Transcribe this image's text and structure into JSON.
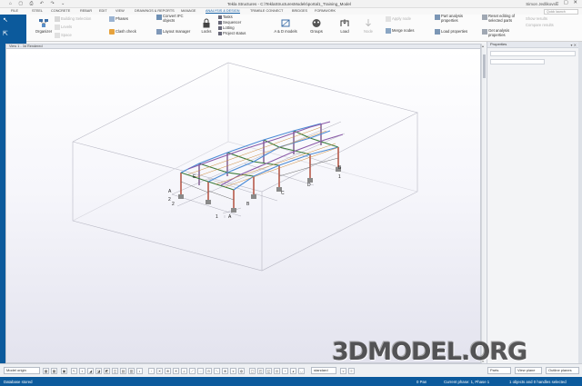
{
  "titlebar": {
    "title": "Tekla Structures - C:\\TeklaStructuresModels\\portal1_Training_Model",
    "user": "Simon Jedlikovski",
    "quick_access_icons": "⌂ ▢ ⎙ ↶ ↷ ⌄",
    "window_buttons": "– ▢ ✕"
  },
  "menu": {
    "tabs": [
      "FILE",
      "STEEL",
      "CONCRETE",
      "REBAR",
      "EDIT",
      "VIEW",
      "DRAWINGS & REPORTS",
      "MANAGE",
      "ANALYSIS & DESIGN",
      "TRIMBLE CONNECT",
      "BRIDGES",
      "FORMWORK"
    ],
    "active_tab": "ANALYSIS & DESIGN",
    "search_placeholder": "Quick launch"
  },
  "ribbon": {
    "organizer": "Organizer",
    "building_selection": "Building Selection",
    "levels": "Levels",
    "space": "Space",
    "phases": "Phases",
    "clash_check": "Clash check",
    "convert_ifc": "Convert IFC objects",
    "layout_manager": "Layout manager",
    "locks": "Locks",
    "tasks": "Tasks",
    "sequencer": "Sequencer",
    "lotting": "Lotting",
    "project_status": "Project status",
    "ad_models": "A & D models",
    "groups": "Groups",
    "load": "Load",
    "node": "Node",
    "merge_nodes": "Merge nodes",
    "apply_node": "Apply node",
    "part_analysis": "Part analysis properties",
    "load_properties": "Load properties",
    "reset_editing": "Reset editing of selected parts",
    "get_analysis": "Get analysis properties",
    "show_results": "Show results",
    "compare_results": "Compare results"
  },
  "view": {
    "header": "View 1 - 3d Rendered",
    "labels": {
      "a1": "A",
      "a2": "2",
      "b1": "1",
      "b2": "A",
      "c1": "1",
      "c2": "B",
      "grid_b": "B",
      "grid_c": "C",
      "grid_d": "D",
      "grid_e": "E",
      "num2": "2"
    }
  },
  "panel": {
    "title": "Properties",
    "controls": "▾ ✕"
  },
  "bottombar": {
    "model_origin": "Model origin",
    "standard": "standard",
    "parts_combo": "Parts",
    "view_plane": "View plane",
    "outline_planes": "Outline planes"
  },
  "status": {
    "left": "Database stored",
    "coords": "0  Pan",
    "phase": "Current phase: 1, Phase 1",
    "selection": "1 objects and 0 handles selected"
  },
  "watermark": "3DMODEL.ORG"
}
